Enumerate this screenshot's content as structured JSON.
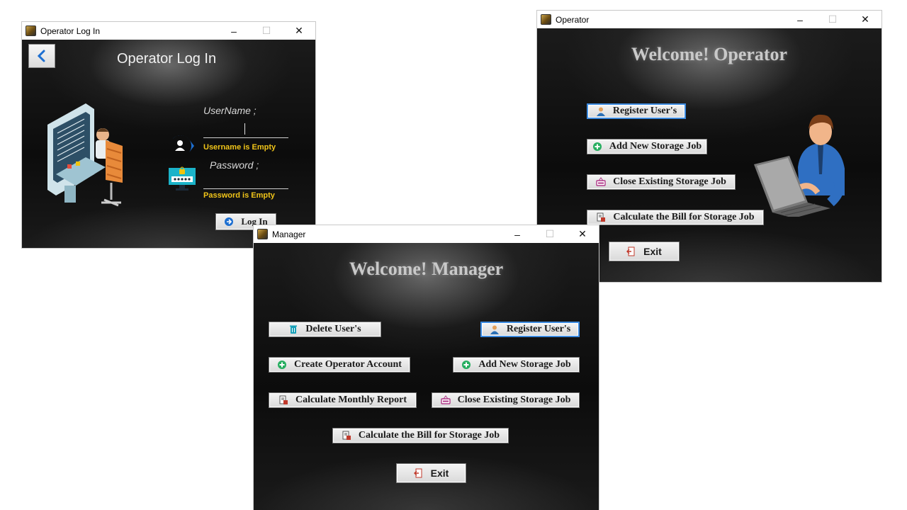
{
  "login_window": {
    "title": "Operator Log In",
    "heading": "Operator Log In",
    "username_label": "UserName ;",
    "username_error": "Username is Empty",
    "password_label": "Password ;",
    "password_error": "Password is Empty",
    "login_button": "Log In"
  },
  "operator_window": {
    "title": "Operator",
    "heading": "Welcome! Operator",
    "buttons": {
      "register": "Register User's",
      "add_job": "Add New Storage Job",
      "close_job": "Close Existing Storage Job",
      "calc_bill": "Calculate the Bill for Storage Job",
      "exit": "Exit"
    }
  },
  "manager_window": {
    "title": "Manager",
    "heading": "Welcome! Manager",
    "buttons": {
      "delete": "Delete User's",
      "register": "Register User's",
      "create_operator": "Create Operator Account",
      "add_job": "Add New Storage Job",
      "monthly_report": "Calculate  Monthly Report",
      "close_job": "Close Existing Storage Job",
      "calc_bill": "Calculate the Bill for Storage Job",
      "exit": "Exit"
    }
  },
  "window_controls": {
    "minimize": "–",
    "maximize": "☐",
    "close": "✕"
  },
  "colors": {
    "error": "#f0c419",
    "focus_border": "#3d8be0",
    "accent_blue": "#1d6fd1"
  }
}
